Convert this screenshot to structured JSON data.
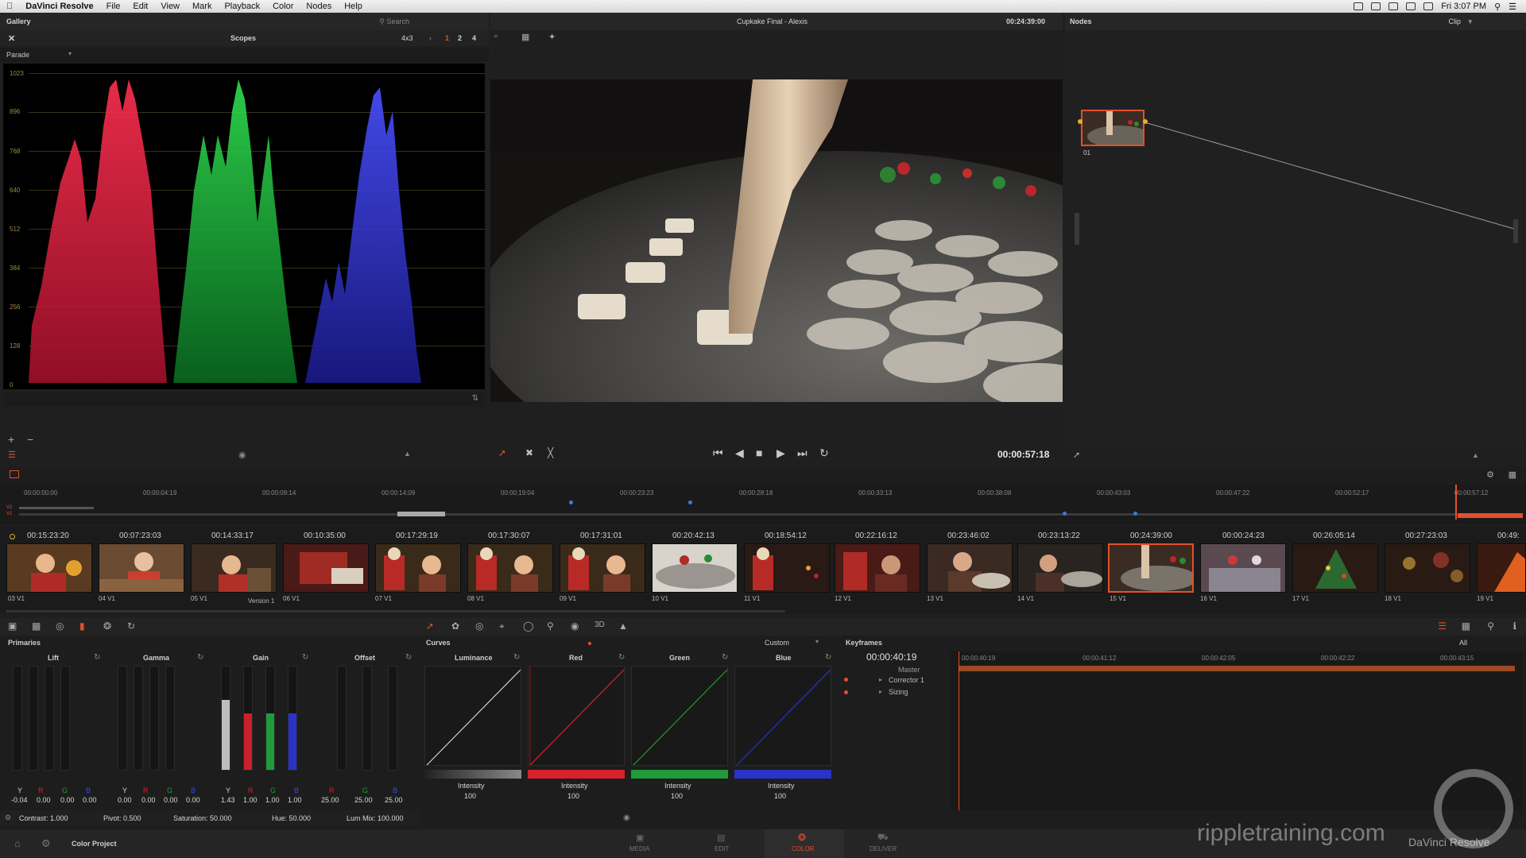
{
  "menubar": {
    "app_name": "DaVinci Resolve",
    "menus": [
      "File",
      "Edit",
      "View",
      "Mark",
      "Playback",
      "Color",
      "Nodes",
      "Help"
    ],
    "clock": "Fri 3:07 PM"
  },
  "left_panel": {
    "gallery_title": "Gallery",
    "search_placeholder": "Search",
    "scopes_title": "Scopes",
    "scope_mode": "Parade",
    "aspect": "4x3",
    "view_nums": [
      "1",
      "2",
      "4"
    ],
    "scale_ticks": [
      "1023",
      "896",
      "768",
      "640",
      "512",
      "384",
      "256",
      "128",
      "0"
    ]
  },
  "viewer": {
    "clip_title": "Cupkake Final - Alexis",
    "source_timecode": "00:24:39:00",
    "current_timecode": "00:00:57:18"
  },
  "nodes": {
    "title": "Nodes",
    "mode": "Clip",
    "node_label": "01"
  },
  "timeline": {
    "ruler": [
      "00:00:00:00",
      "00:00:04:19",
      "00:00:09:14",
      "00:00:14:09",
      "00:00:19:04",
      "00:00:23:23",
      "00:00:28:18",
      "00:00:33:13",
      "00:00:38:08",
      "00:00:43:03",
      "00:00:47:22",
      "00:00:52:17",
      "00:00:57:12"
    ],
    "track_labels": [
      "V2",
      "V1"
    ]
  },
  "clips": [
    {
      "tc": "00:15:23:20",
      "label": "03",
      "track": "V1"
    },
    {
      "tc": "00:07:23:03",
      "label": "04",
      "track": "V1"
    },
    {
      "tc": "00:14:33:17",
      "label": "05",
      "track": "V1",
      "version": "Version 1"
    },
    {
      "tc": "00:10:35:00",
      "label": "06",
      "track": "V1"
    },
    {
      "tc": "00:17:29:19",
      "label": "07",
      "track": "V1"
    },
    {
      "tc": "00:17:30:07",
      "label": "08",
      "track": "V1"
    },
    {
      "tc": "00:17:31:01",
      "label": "09",
      "track": "V1"
    },
    {
      "tc": "00:20:42:13",
      "label": "10",
      "track": "V1"
    },
    {
      "tc": "00:18:54:12",
      "label": "11",
      "track": "V1"
    },
    {
      "tc": "00:22:16:12",
      "label": "12",
      "track": "V1"
    },
    {
      "tc": "00:23:46:02",
      "label": "13",
      "track": "V1"
    },
    {
      "tc": "00:23:13:22",
      "label": "14",
      "track": "V1"
    },
    {
      "tc": "00:24:39:00",
      "label": "15",
      "track": "V1"
    },
    {
      "tc": "00:00:24:23",
      "label": "16",
      "track": "V1"
    },
    {
      "tc": "00:26:05:14",
      "label": "17",
      "track": "V1"
    },
    {
      "tc": "00:27:23:03",
      "label": "18",
      "track": "V1"
    },
    {
      "tc": "00:49:",
      "label": "19",
      "track": "V1"
    }
  ],
  "primaries": {
    "title": "Primaries",
    "wheels": [
      {
        "name": "Lift",
        "y": "-0.04",
        "r": "0.00",
        "g": "0.00",
        "b": "0.00"
      },
      {
        "name": "Gamma",
        "y": "0.00",
        "r": "0.00",
        "g": "0.00",
        "b": "0.00"
      },
      {
        "name": "Gain",
        "y": "1.43",
        "r": "1.00",
        "g": "1.00",
        "b": "1.00"
      },
      {
        "name": "Offset",
        "y": "",
        "r": "25.00",
        "g": "25.00",
        "b": "25.00"
      }
    ],
    "channel_letters": {
      "y": "Y",
      "r": "R",
      "g": "G",
      "b": "B"
    },
    "footer": {
      "contrast": "Contrast: 1.000",
      "pivot": "Pivot: 0.500",
      "saturation": "Saturation: 50.000",
      "hue": "Hue: 50.000",
      "lummix": "Lum Mix: 100.000"
    },
    "gain_bar_levels": {
      "y": 0.68,
      "r": 0.55,
      "g": 0.55,
      "b": 0.55
    }
  },
  "curves": {
    "title": "Curves",
    "mode": "Custom",
    "channels": [
      {
        "name": "Luminance",
        "intensity_label": "Intensity",
        "intensity": "100",
        "color": "#cfcfcf"
      },
      {
        "name": "Red",
        "intensity_label": "Intensity",
        "intensity": "100",
        "color": "#d8222c"
      },
      {
        "name": "Green",
        "intensity_label": "Intensity",
        "intensity": "100",
        "color": "#1f9b3a"
      },
      {
        "name": "Blue",
        "intensity_label": "Intensity",
        "intensity": "100",
        "color": "#2a33c8"
      }
    ]
  },
  "keyframes": {
    "title": "Keyframes",
    "filter": "All",
    "timecode": "00:00:40:19",
    "ruler": [
      "00:00:40:19",
      "00:00:41:12",
      "00:00:42:05",
      "00:00:42:22",
      "00:00:43:15"
    ],
    "rows": [
      "Master",
      "Corrector 1",
      "Sizing"
    ]
  },
  "footer": {
    "project": "Color Project",
    "pages": [
      "MEDIA",
      "EDIT",
      "COLOR",
      "DELIVER"
    ],
    "active_page": "COLOR"
  },
  "watermark": {
    "text": "rippletraining.com",
    "product": "DaVinci Resolve"
  },
  "colors": {
    "accent": "#e2502b",
    "panel": "#1f1f20",
    "header": "#262627"
  }
}
